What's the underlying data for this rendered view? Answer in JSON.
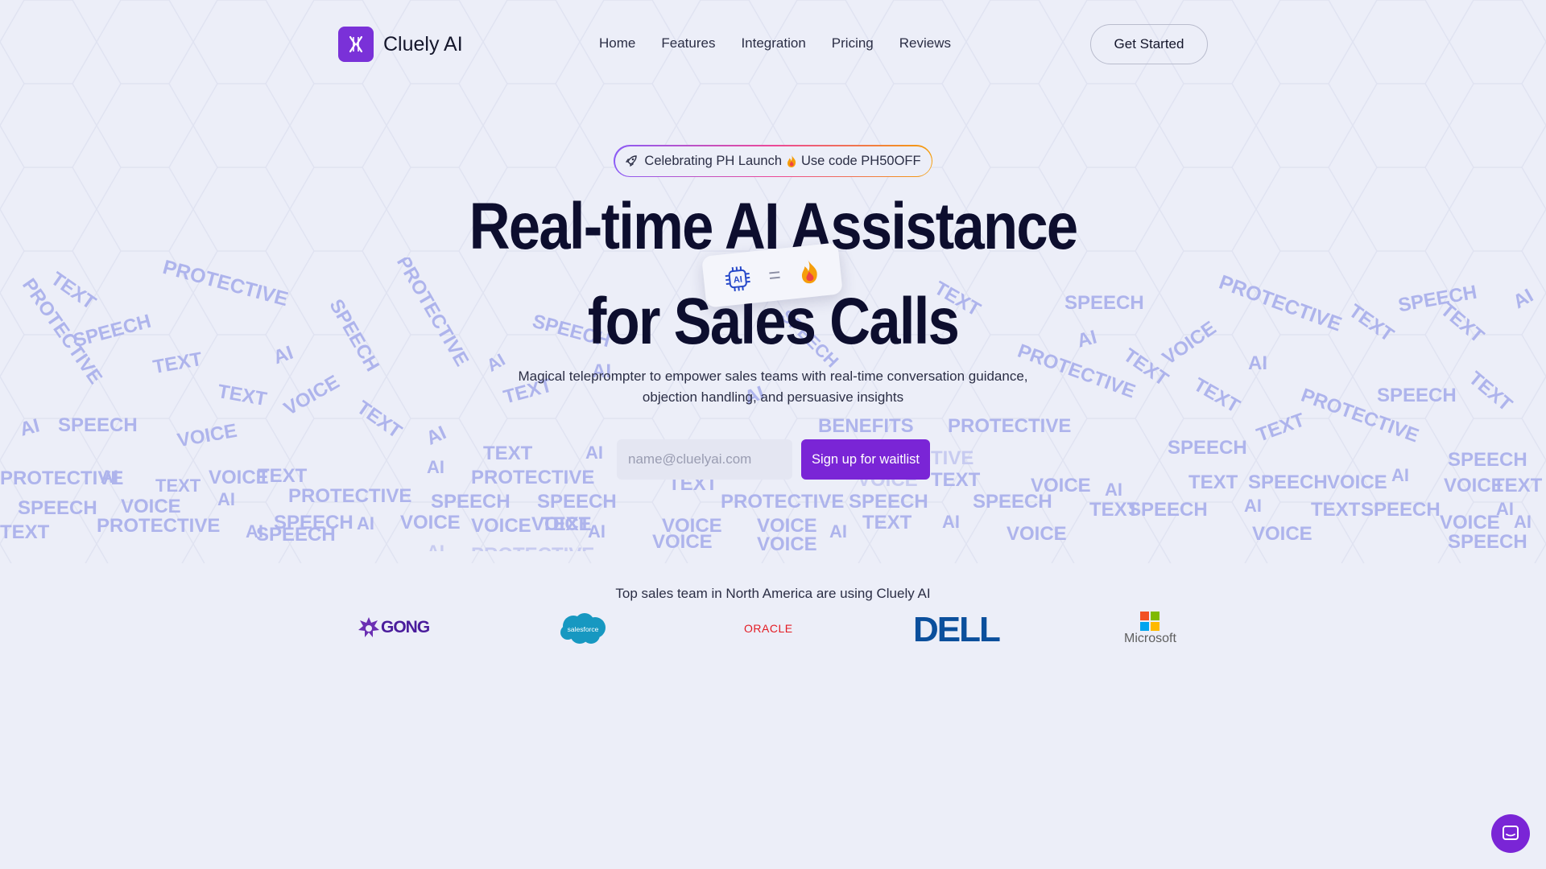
{
  "header": {
    "brand_name": "Cluely AI",
    "nav": [
      "Home",
      "Features",
      "Integration",
      "Pricing",
      "Reviews"
    ],
    "cta_label": "Get Started"
  },
  "promo": {
    "text_before": "Celebrating PH Launch",
    "text_after": "Use code PH50OFF"
  },
  "hero": {
    "title_line1": "Real-time AI Assistance",
    "title_line2": "for Sales Calls",
    "floating_card_badge": "AI",
    "subtitle_line1": "Magical teleprompter to empower sales teams with real-time conversation guidance,",
    "subtitle_line2": "objection handling, and persuasive insights"
  },
  "waitlist": {
    "email_placeholder": "name@cluelyai.com",
    "button_label": "Sign up for waitlist"
  },
  "background_words": [
    "TEXT",
    "PROTECTIVE",
    "SPEECH",
    "AI",
    "VOICE",
    "BENEFITS"
  ],
  "trusted": {
    "heading": "Top sales team in North America are using Cluely AI",
    "logos": [
      {
        "name": "gong-logo",
        "text": "GONG",
        "color": "#4a1c9c"
      },
      {
        "name": "salesforce-logo",
        "text": "salesforce",
        "color": "#1798c1"
      },
      {
        "name": "oracle-logo",
        "text": "ORACLE",
        "color": "#e31b23"
      },
      {
        "name": "dell-logo",
        "text": "DELL",
        "color": "#0b4f9c"
      },
      {
        "name": "microsoft-logo",
        "text": "Microsoft",
        "color": "#5e5e5e"
      }
    ]
  },
  "colors": {
    "brand_purple": "#7a25d6",
    "heading_navy": "#0d0e2e",
    "word_cloud": "#aeb4ec",
    "page_bg": "#eceef8"
  },
  "icons": [
    "rocket-icon",
    "fire-icon",
    "ai-chip-icon",
    "chat-icon"
  ]
}
